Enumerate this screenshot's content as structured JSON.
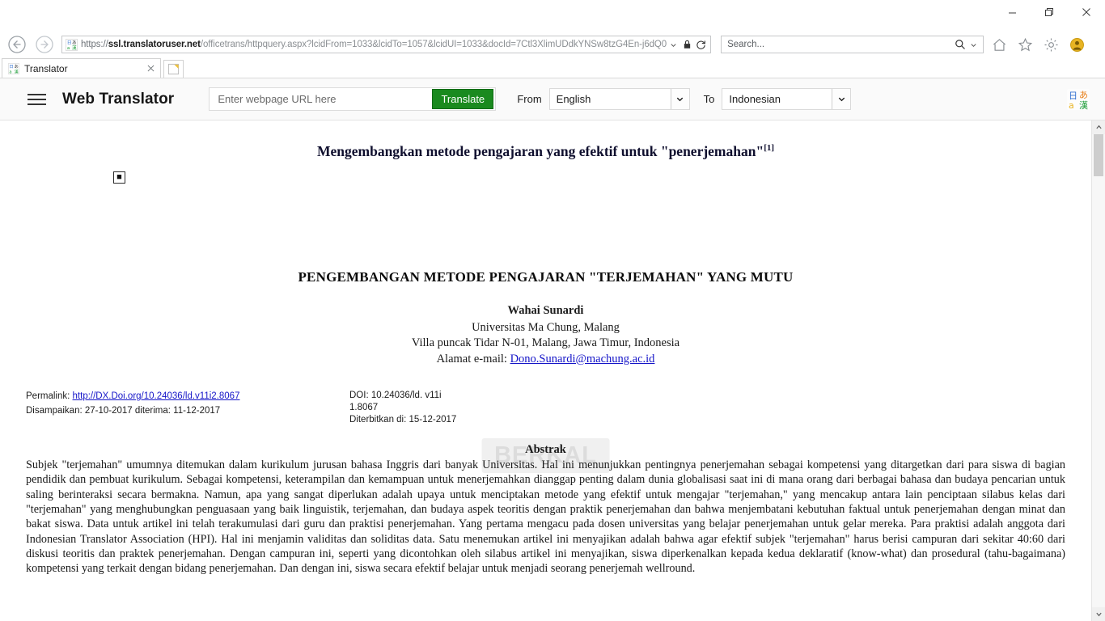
{
  "browser": {
    "window_controls": {
      "minimize": "minimize-icon",
      "restore": "restore-icon",
      "close": "close-icon"
    },
    "nav": {
      "back": "back-arrow-icon",
      "forward": "forward-arrow-icon"
    },
    "address": {
      "scheme": "https://",
      "host": "ssl.translatoruser.net",
      "path": "/officetrans/httpquery.aspx?lcidFrom=1033&lcidTo=1057&lcidUI=1033&docId=7Ctl3XlimUDdkYNSw8tzG4En-j6dQ0",
      "full": "https://ssl.translatoruser.net/officetrans/httpquery.aspx?lcidFrom=1033&lcidTo=1057&lcidUI=1033&docId=7Ctl3XlimUDdkYNSw8tzG4En-j6dQ0",
      "dropdown_icon": "chevron-down-icon",
      "lock_icon": "lock-icon",
      "refresh_icon": "refresh-icon"
    },
    "search": {
      "placeholder": "Search...",
      "value": "Search...",
      "icon": "search-icon",
      "dropdown_icon": "chevron-down-icon"
    },
    "toolbar_icons": [
      {
        "name": "home-icon",
        "glyph": "home"
      },
      {
        "name": "favorites-star-icon",
        "glyph": "star"
      },
      {
        "name": "settings-gear-icon",
        "glyph": "gear"
      },
      {
        "name": "user-account-icon",
        "glyph": "person",
        "color": "#e0a800"
      }
    ],
    "tabs": [
      {
        "label": "Translator",
        "favicon": "translator-favicon",
        "close_icon": "close-icon"
      }
    ],
    "new_tab_label": "",
    "new_tab_icon": "new-tab-icon"
  },
  "translator_bar": {
    "menu_icon": "hamburger-menu-icon",
    "brand": "Web Translator",
    "url_input": {
      "placeholder": "Enter webpage URL here",
      "value": ""
    },
    "translate_button": "Translate",
    "from_label": "From",
    "from_value": "English",
    "to_label": "To",
    "to_value": "Indonesian",
    "dropdown_icon": "chevron-down-icon",
    "app_icon": "microsoft-translator-icon",
    "accent_green": "#1a8a1f"
  },
  "document": {
    "translated_title": "Mengembangkan metode pengajaran yang efektif untuk \"penerjemahan\"",
    "translated_title_ref": "[1]",
    "broken_image": "broken-image-placeholder",
    "watermark": "BERKAL",
    "paper_title": "PENGEMBANGAN METODE PENGAJARAN \"TERJEMAHAN\" YANG MUTU",
    "author": "Wahai Sunardi",
    "affiliation": "Universitas Ma Chung, Malang",
    "address": "Villa puncak Tidar N-01, Malang, Jawa Timur, Indonesia",
    "email_label": "Alamat e-mail: ",
    "email": "Dono.Sunardi@machung.ac.id",
    "permalink_label": "Permalink: ",
    "permalink": "http://DX.Doi.org/10.24036/ld.v11i2.8067",
    "submitted_line": "Disampaikan: 27-10-2017 diterima: 11-12-2017",
    "doi_line1": "DOI: 10.24036/ld. v11i",
    "doi_line2": "1.8067",
    "published_line": "Diterbitkan di: 15-12-2017",
    "abstract_heading": "Abstrak",
    "abstract": "Subjek \"terjemahan\" umumnya ditemukan dalam kurikulum jurusan bahasa Inggris dari banyak Universitas. Hal ini menunjukkan pentingnya penerjemahan sebagai kompetensi yang ditargetkan dari para siswa di bagian pendidik dan pembuat kurikulum. Sebagai kompetensi, keterampilan dan kemampuan untuk menerjemahkan dianggap penting dalam dunia globalisasi saat ini di mana orang dari berbagai bahasa dan budaya pencarian untuk saling berinteraksi secara bermakna. Namun, apa yang sangat diperlukan adalah upaya untuk menciptakan metode yang efektif untuk mengajar \"terjemahan,\" yang mencakup antara lain penciptaan silabus kelas dari \"terjemahan\" yang menghubungkan penguasaan yang baik linguistik, terjemahan, dan budaya aspek teoritis dengan praktik penerjemahan dan bahwa menjembatani kebutuhan faktual untuk penerjemahan dengan minat dan bakat siswa. Data untuk artikel ini telah terakumulasi dari guru dan praktisi penerjemahan. Yang pertama mengacu pada dosen universitas yang belajar penerjemahan untuk gelar mereka. Para praktisi adalah anggota dari Indonesian Translator Association (HPI). Hal ini menjamin validitas dan soliditas data. Satu menemukan artikel ini menyajikan adalah bahwa agar efektif subjek \"terjemahan\" harus berisi campuran dari sekitar 40:60 dari diskusi teoritis dan praktek penerjemahan. Dengan campuran ini, seperti yang dicontohkan oleh silabus artikel ini menyajikan, siswa diperkenalkan kepada kedua deklaratif (know-what) dan prosedural (tahu-bagaimana) kompetensi yang terkait dengan bidang penerjemahan. Dan dengan ini, siswa secara efektif belajar untuk menjadi seorang penerjemah wellround."
  },
  "scrollbar": {
    "up_icon": "chevron-up-icon",
    "down_icon": "chevron-down-icon"
  }
}
